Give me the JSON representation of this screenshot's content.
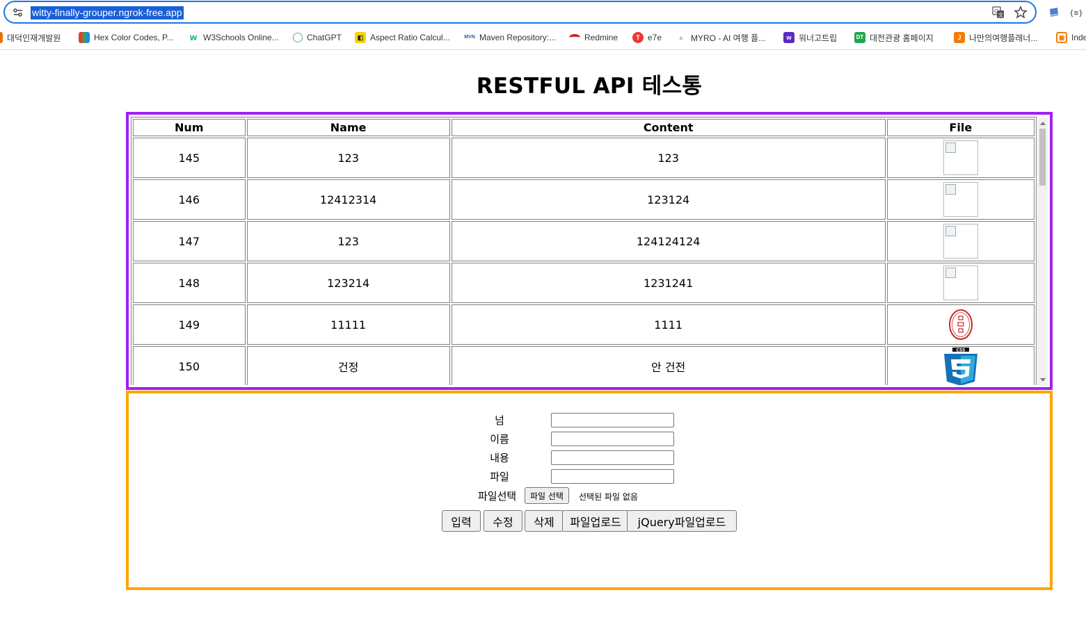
{
  "browser": {
    "url": "witty-finally-grouper.ngrok-free.app",
    "bookmarks": [
      {
        "label": "대덕인재개발원",
        "icon": "orange-favicon"
      },
      {
        "label": "Hex Color Codes, P...",
        "icon": "color-books-favicon"
      },
      {
        "label": "W3Schools Online...",
        "icon": "w3schools-favicon"
      },
      {
        "label": "ChatGPT",
        "icon": "chatgpt-favicon"
      },
      {
        "label": "Aspect Ratio Calcul...",
        "icon": "calculator-favicon"
      },
      {
        "label": "Maven Repository:...",
        "icon": "maven-favicon"
      },
      {
        "label": "Redmine",
        "icon": "redmine-favicon"
      },
      {
        "label": "e7e",
        "icon": "e7e-favicon"
      },
      {
        "label": "MYRO - AI 여행 플...",
        "icon": "myro-favicon"
      },
      {
        "label": "워너고트립",
        "icon": "wannago-favicon"
      },
      {
        "label": "대전관광 홈페이지",
        "icon": "dt-favicon"
      },
      {
        "label": "나만의여행플래너...",
        "icon": "planner-favicon"
      },
      {
        "label": "Inde",
        "icon": "index-favicon"
      }
    ],
    "colors": {
      "omnibox_border": "#1a73e8",
      "url_highlight": "#1a5fd6"
    }
  },
  "page": {
    "title": "RESTFUL API 테스통",
    "table": {
      "headers": [
        "Num",
        "Name",
        "Content",
        "File"
      ],
      "rows": [
        {
          "num": "145",
          "name": "123",
          "content": "123",
          "file": "broken-image"
        },
        {
          "num": "146",
          "name": "12412314",
          "content": "123124",
          "file": "broken-image"
        },
        {
          "num": "147",
          "name": "123",
          "content": "124124124",
          "file": "broken-image"
        },
        {
          "num": "148",
          "name": "123214",
          "content": "1231241",
          "file": "broken-image"
        },
        {
          "num": "149",
          "name": "11111",
          "content": "1111",
          "file": "red-seal-image"
        },
        {
          "num": "150",
          "name": "건정",
          "content": "안 건전",
          "file": "css3-logo-image"
        }
      ],
      "border_color": "#a020f0"
    },
    "form": {
      "fields": [
        {
          "label": "넘",
          "value": ""
        },
        {
          "label": "이름",
          "value": ""
        },
        {
          "label": "내용",
          "value": ""
        },
        {
          "label": "파일",
          "value": ""
        }
      ],
      "file_select_label": "파일선택",
      "file_button": "파일 선택",
      "file_status": "선택된 파일 없음",
      "buttons": [
        "입력",
        "수정",
        "삭제",
        "파일업로드",
        "jQuery파일업로드"
      ],
      "border_color": "#ffa500"
    }
  }
}
